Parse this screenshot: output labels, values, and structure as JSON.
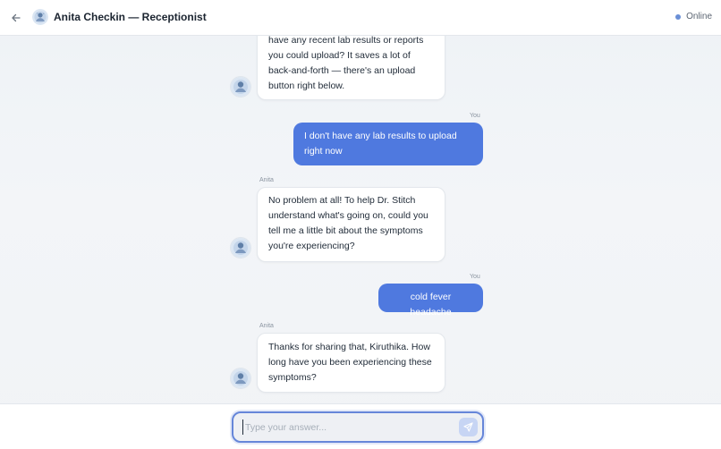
{
  "header": {
    "title": "Anita Checkin — Receptionist",
    "status": "Online",
    "back_icon": "arrow-left-icon",
    "avatar_icon": "receptionist-avatar-icon"
  },
  "messages": [
    {
      "role": "bot",
      "sender": "",
      "lines": [
        "have any recent lab results or reports",
        "you could upload? It saves a lot of",
        "back-and-forth — there's an upload",
        "button right below."
      ]
    },
    {
      "role": "user",
      "sender": "You",
      "lines": [
        "I don't have any lab results to upload",
        "right now"
      ]
    },
    {
      "role": "bot",
      "sender": "Anita",
      "lines": [
        "No problem at all! To help Dr. Stitch",
        "understand what's going on, could you",
        "tell me a little bit about the symptoms",
        "you're experiencing?"
      ]
    },
    {
      "role": "user",
      "sender": "You",
      "lines": [
        "cold fever headache"
      ]
    },
    {
      "role": "bot",
      "sender": "Anita",
      "lines": [
        "Thanks for sharing that, Kiruthika. How",
        "long have you been experiencing these",
        "symptoms?"
      ]
    }
  ],
  "composer": {
    "placeholder": "Type your answer...",
    "send_icon": "send-icon"
  },
  "colors": {
    "accent": "#4f79df",
    "status_dot": "#6a8fd6"
  }
}
